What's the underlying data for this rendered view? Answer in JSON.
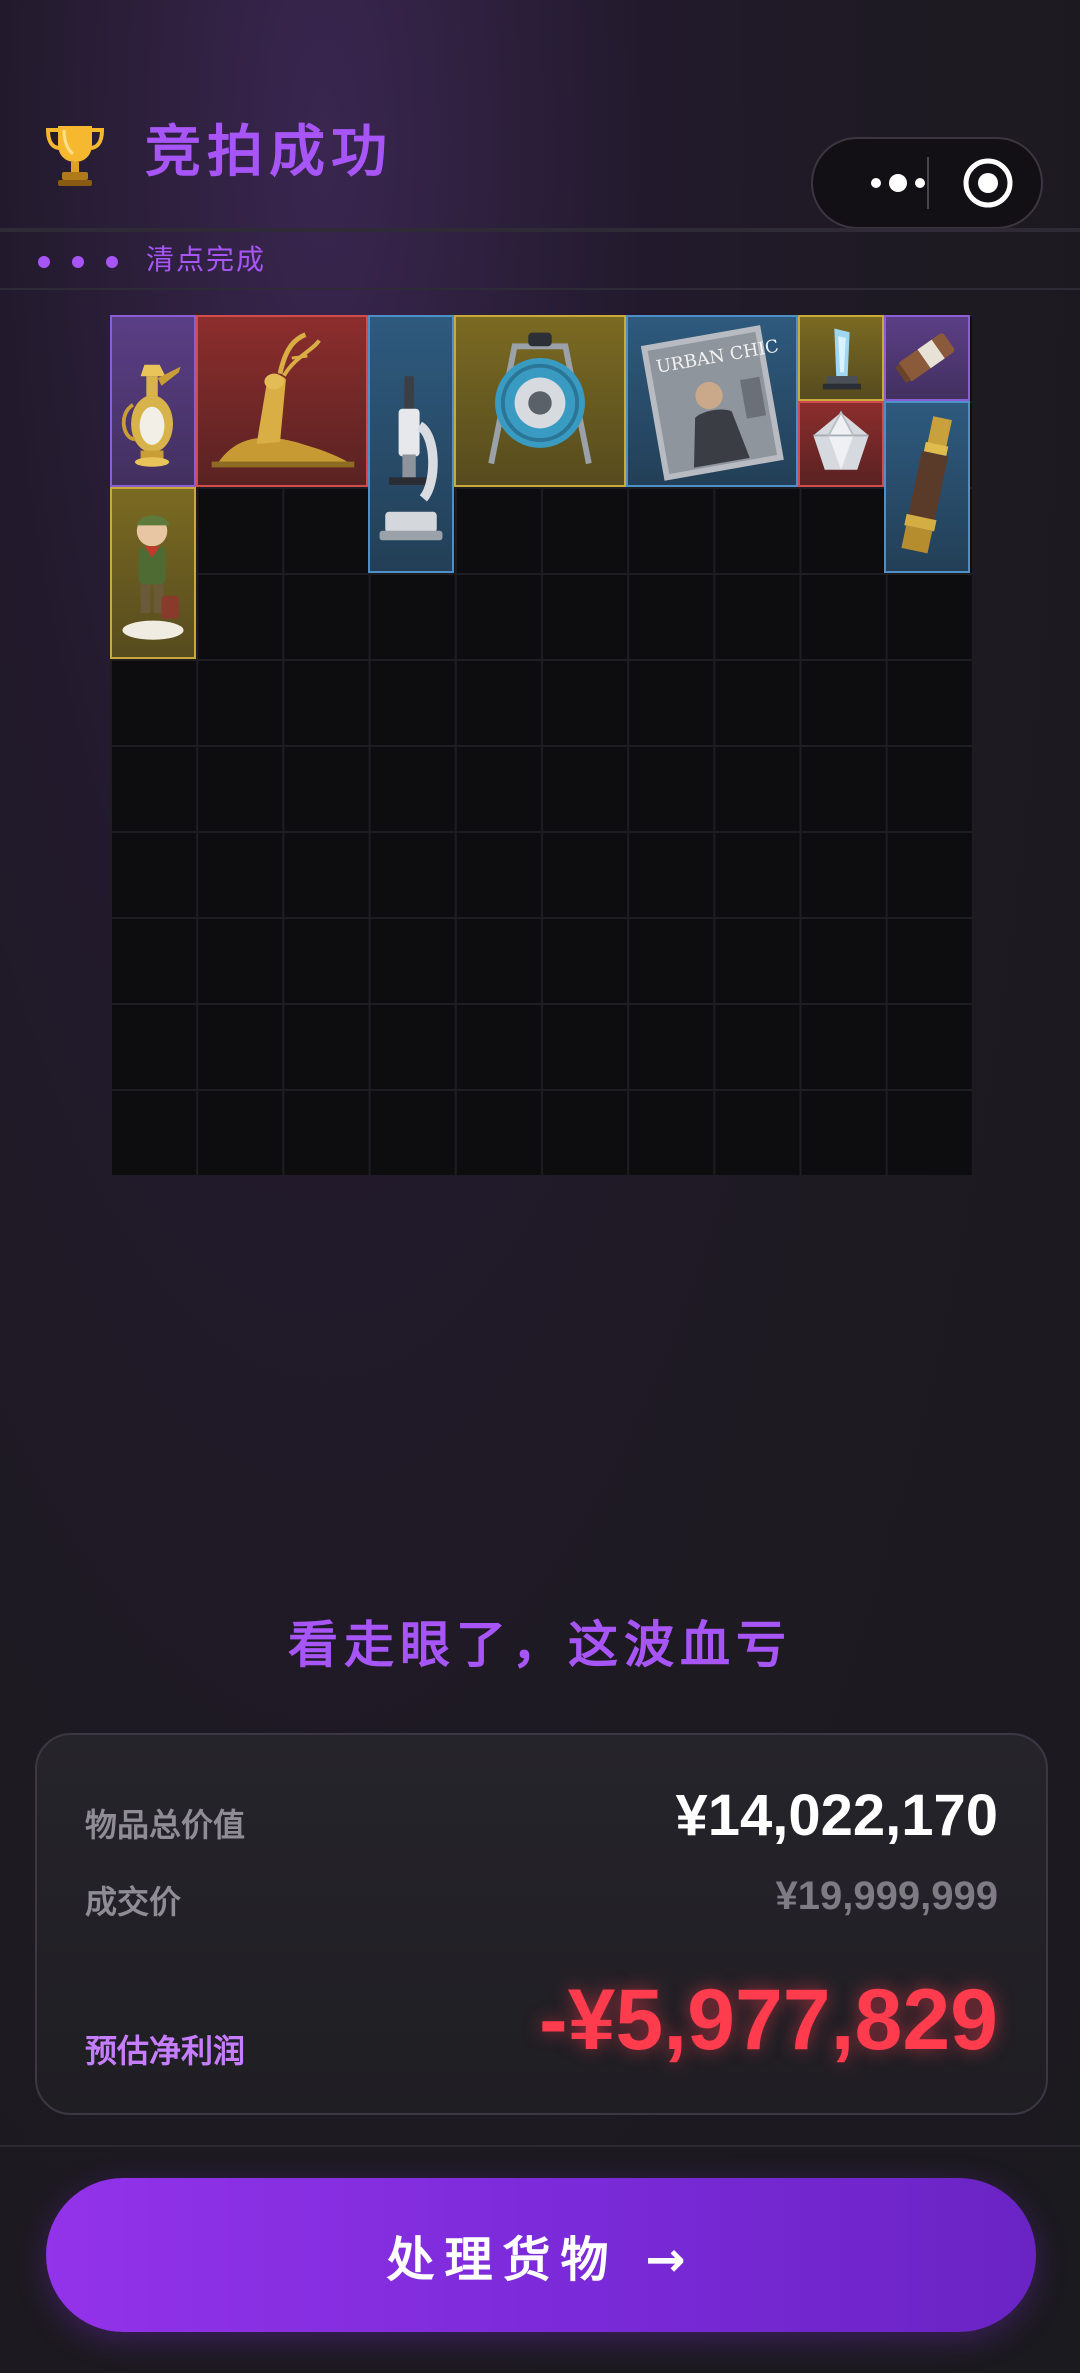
{
  "header": {
    "title": "竞拍成功",
    "trophy_icon": "trophy-icon",
    "capsule": {
      "more_icon": "more-dots-icon",
      "close_icon": "target-close-icon"
    }
  },
  "status": {
    "text": "清点完成",
    "dots": 3,
    "accent": "#a855f7"
  },
  "inventory": {
    "columns": 10,
    "rows": 10,
    "items": [
      {
        "name": "golden-ewer",
        "rarity": "purple"
      },
      {
        "name": "golden-deer-statue",
        "rarity": "red"
      },
      {
        "name": "microscope",
        "rarity": "blue"
      },
      {
        "name": "cable-reel",
        "rarity": "gold"
      },
      {
        "name": "fashion-magazine",
        "rarity": "blue",
        "cover_text": "URBAN CHIC"
      },
      {
        "name": "crystal-trophy",
        "rarity": "gold"
      },
      {
        "name": "energy-bar",
        "rarity": "purple"
      },
      {
        "name": "diamond",
        "rarity": "red"
      },
      {
        "name": "spyglass",
        "rarity": "blue"
      },
      {
        "name": "boy-figurine",
        "rarity": "gold"
      }
    ],
    "rarity_colors": {
      "purple": "#8a5fd6",
      "red": "#d14c4c",
      "blue": "#4f8fc7",
      "gold": "#c9a93a"
    }
  },
  "verdict": "看走眼了，这波血亏",
  "summary": {
    "total_value_label": "物品总价值",
    "total_value": "¥14,022,170",
    "deal_price_label": "成交价",
    "deal_price": "¥19,999,999",
    "net_profit_label": "预估净利润",
    "net_profit": "-¥5,977,829",
    "profit_color": "#ff3b4e"
  },
  "cta": {
    "label": "处理货物 →"
  }
}
